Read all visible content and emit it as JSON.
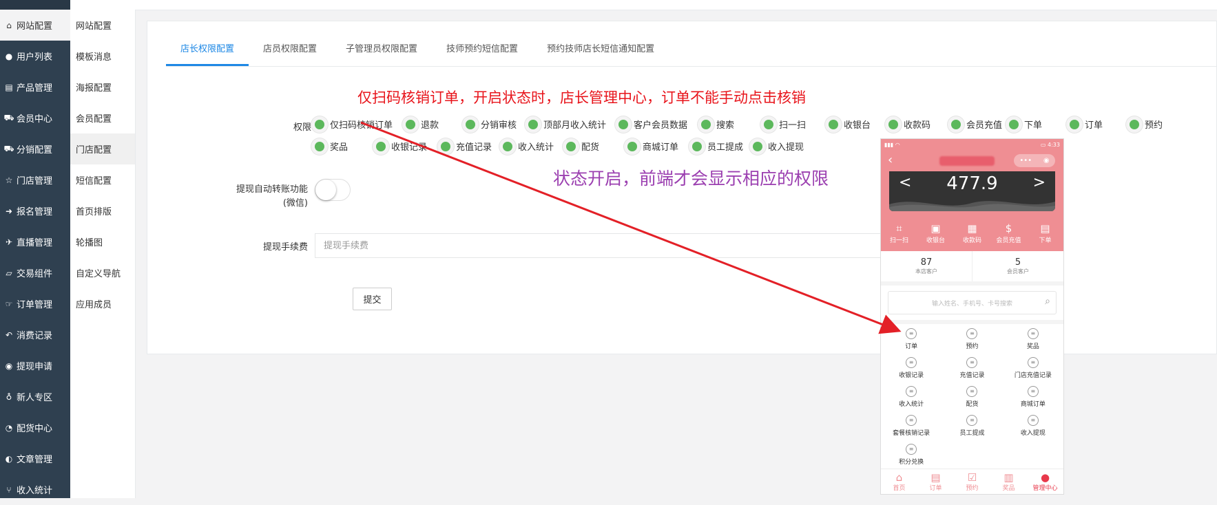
{
  "sidebar": {
    "items": [
      {
        "icon": "home-icon",
        "glyph": "⌂",
        "label": "网站配置"
      },
      {
        "icon": "user-icon",
        "glyph": "●",
        "label": "用户列表"
      },
      {
        "icon": "product-icon",
        "glyph": "▤",
        "label": "产品管理"
      },
      {
        "icon": "cart-icon",
        "glyph": "⛟",
        "label": "会员中心"
      },
      {
        "icon": "cart-icon",
        "glyph": "⛟",
        "label": "分销配置"
      },
      {
        "icon": "star-icon",
        "glyph": "☆",
        "label": "门店管理"
      },
      {
        "icon": "signin-icon",
        "glyph": "➜",
        "label": "报名管理"
      },
      {
        "icon": "plane-icon",
        "glyph": "✈",
        "label": "直播管理"
      },
      {
        "icon": "eraser-icon",
        "glyph": "▱",
        "label": "交易组件"
      },
      {
        "icon": "hand-icon",
        "glyph": "☞",
        "label": "订单管理"
      },
      {
        "icon": "reply-icon",
        "glyph": "↶",
        "label": "消费记录"
      },
      {
        "icon": "wechat-icon",
        "glyph": "◉",
        "label": "提现申请"
      },
      {
        "icon": "pin-icon",
        "glyph": "♁",
        "label": "新人专区"
      },
      {
        "icon": "pie-icon",
        "glyph": "◔",
        "label": "配货中心"
      },
      {
        "icon": "adjust-icon",
        "glyph": "◐",
        "label": "文章管理"
      },
      {
        "icon": "fork-icon",
        "glyph": "⑂",
        "label": "收入统计"
      }
    ]
  },
  "subnav": {
    "items": [
      "网站配置",
      "模板消息",
      "海报配置",
      "会员配置",
      "门店配置",
      "短信配置",
      "首页排版",
      "轮播图",
      "自定义导航",
      "应用成员"
    ]
  },
  "tabs": [
    "店长权限配置",
    "店员权限配置",
    "子管理员权限配置",
    "技师预约短信配置",
    "预约技师店长短信通知配置"
  ],
  "annotations": {
    "top": "仅扫码核销订单，开启状态时，店长管理中心，订单不能手动点击核销",
    "middle": "状态开启，前端才会显示相应的权限"
  },
  "form": {
    "perm_label": "权限",
    "permissions": [
      "仅扫码核销订单",
      "退款",
      "分销审核",
      "顶部月收入统计",
      "客户会员数据",
      "搜索",
      "扫一扫",
      "收银台",
      "收款码",
      "会员充值",
      "下单",
      "订单",
      "预约",
      "奖品",
      "收银记录",
      "充值记录",
      "收入统计",
      "配货",
      "商城订单",
      "员工提成",
      "收入提现"
    ],
    "auto_transfer_label": "提现自动转账功能",
    "auto_transfer_sub": "(微信)",
    "fee_label": "提现手续费",
    "fee_placeholder": "提现手续费",
    "submit": "提交",
    "accent_color": "#1e88e5",
    "on_color": "#5cb85c"
  },
  "phone": {
    "balance": "477.9",
    "prev": "<",
    "next": ">",
    "quick": [
      {
        "icon": "scan-icon",
        "glyph": "⌗",
        "label": "扫一扫"
      },
      {
        "icon": "cashier-icon",
        "glyph": "▣",
        "label": "收银台"
      },
      {
        "icon": "qrcode-icon",
        "glyph": "▦",
        "label": "收款码"
      },
      {
        "icon": "recharge-icon",
        "glyph": "$",
        "label": "会员充值"
      },
      {
        "icon": "order-icon",
        "glyph": "▤",
        "label": "下单"
      }
    ],
    "stats": [
      {
        "value": "87",
        "label": "本店客户"
      },
      {
        "value": "5",
        "label": "会员客户"
      }
    ],
    "search_placeholder": "输入姓名、手机号、卡号搜索",
    "grid": [
      "订单",
      "预约",
      "奖品",
      "收银记录",
      "充值记录",
      "门店充值记录",
      "收入统计",
      "配货",
      "商城订单",
      "套餐核销记录",
      "员工提成",
      "收入提现",
      "积分兑换"
    ],
    "tabbar": [
      {
        "icon": "home-icon",
        "glyph": "⌂",
        "label": "首页"
      },
      {
        "icon": "order-icon",
        "glyph": "▤",
        "label": "订单"
      },
      {
        "icon": "calendar-icon",
        "glyph": "☑",
        "label": "预约"
      },
      {
        "icon": "gift-icon",
        "glyph": "▥",
        "label": "奖品"
      },
      {
        "icon": "person-icon",
        "glyph": "●",
        "label": "管理中心"
      }
    ]
  }
}
